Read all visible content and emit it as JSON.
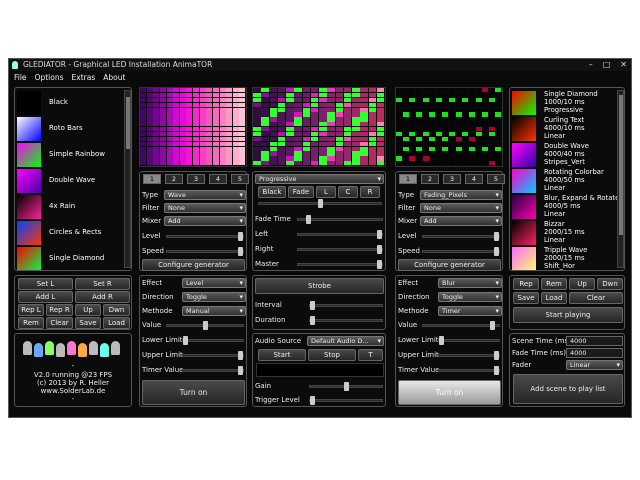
{
  "window": {
    "title": "GLEDIATOR - Graphical LED Installation AnimaTOR",
    "min": "–",
    "max": "□",
    "close": "✕"
  },
  "menu": [
    "File",
    "Options",
    "Extras",
    "About"
  ],
  "generator_list": [
    {
      "label": "Black",
      "colors": [
        "#000000",
        "#000000"
      ]
    },
    {
      "label": "Roto Bars",
      "colors": [
        "#ffffff",
        "#0000ff"
      ]
    },
    {
      "label": "Simple Rainbow",
      "colors": [
        "#ff00ff",
        "#00ff00"
      ]
    },
    {
      "label": "Double Wave",
      "colors": [
        "#ff00ff",
        "#4400aa"
      ]
    },
    {
      "label": "4x Rain",
      "colors": [
        "#000000",
        "#ff2299"
      ]
    },
    {
      "label": "Circles & Rects",
      "colors": [
        "#0044ff",
        "#ff3300"
      ]
    },
    {
      "label": "Single Diamond",
      "colors": [
        "#ff0000",
        "#00ff44"
      ]
    }
  ],
  "tabs": [
    "1",
    "2",
    "3",
    "4",
    "5"
  ],
  "left_panel": {
    "type_label": "Type",
    "type_value": "Wave",
    "filter_label": "Filter",
    "filter_value": "None",
    "mixer_label": "Mixer",
    "mixer_value": "Add",
    "level_label": "Level",
    "speed_label": "Speed",
    "level": 1.0,
    "speed": 1.0,
    "config_btn": "Configure generator"
  },
  "center_panel": {
    "mix_value": "Progressive",
    "buttons": [
      "Black",
      "Fade",
      "L",
      "C",
      "R"
    ],
    "fade_label": "Fade Time",
    "left_label": "Left",
    "right_label": "Right",
    "master_label": "Master",
    "cross": 0.5,
    "fade": 0.1,
    "left": 1.0,
    "right": 1.0,
    "master": 1.0
  },
  "right_panel": {
    "type_label": "Type",
    "type_value": "Fading_Pixels",
    "filter_label": "Filter",
    "filter_value": "None",
    "mixer_label": "Mixer",
    "mixer_value": "Add",
    "level_label": "Level",
    "speed_label": "Speed",
    "level": 1.0,
    "speed": 1.0,
    "config_btn": "Configure generator"
  },
  "playlist": [
    {
      "name": "Single Diamond",
      "time": "1000/10 ms",
      "mode": "Progressive"
    },
    {
      "name": "Curling Text",
      "time": "4000/10 ms",
      "mode": "Linear"
    },
    {
      "name": "Double Wave",
      "time": "4000/40 ms",
      "mode": "Stripes_Vert"
    },
    {
      "name": "Rotating Colorbar",
      "time": "4000/50 ms",
      "mode": "Linear"
    },
    {
      "name": "Blur, Expand & Rotate",
      "time": "4000/5 ms",
      "mode": "Linear"
    },
    {
      "name": "Bizzar",
      "time": "2000/15 ms",
      "mode": "Linear"
    },
    {
      "name": "Tripple Wave",
      "time": "2000/15 ms",
      "mode": "Shift_Hor"
    }
  ],
  "set_buttons": [
    "Set L",
    "Set R",
    "Add L",
    "Add R",
    "Rep L",
    "Rep R",
    "Up",
    "Dwn",
    "Rem",
    "Clear",
    "Save",
    "Load"
  ],
  "info": {
    "version": "V2.0 running @23 FPS",
    "copyright": "(c) 2013 by R. Heller",
    "url": "www.SolderLab.de",
    "dash1": "-",
    "dash2": "-"
  },
  "effect_left": {
    "effect_label": "Effect",
    "effect_value": "Level",
    "direction_label": "Direction",
    "direction_value": "Toggle",
    "methode_label": "Methode",
    "methode_value": "Manual",
    "value_label": "Value",
    "value": 0.5,
    "lower_label": "Lower Limit",
    "lower": 0.0,
    "upper_label": "Upper Limit",
    "upper": 1.0,
    "timer_label": "Timer Value",
    "timer": 1.0,
    "turn_on": "Turn on"
  },
  "strobe": {
    "button": "Strobe",
    "interval_label": "Interval",
    "duration_label": "Duration",
    "interval": 0.0,
    "duration": 0.0
  },
  "audio": {
    "source_label": "Audio Source",
    "source_value": "Default Audio D...",
    "start": "Start",
    "stop": "Stop",
    "t": "T",
    "gain_label": "Gain",
    "trigger_label": "Trigger Level",
    "gain": 0.5,
    "trigger": 0.0
  },
  "effect_right": {
    "effect_label": "Effect",
    "effect_value": "Blur",
    "direction_label": "Direction",
    "direction_value": "Toggle",
    "methode_label": "Methode",
    "methode_value": "Timer",
    "value_label": "Value",
    "value": 0.95,
    "lower_label": "Lower Limit",
    "lower": 0.0,
    "upper_label": "Upper Limit",
    "upper": 1.0,
    "timer_label": "Timer Value",
    "timer": 1.0,
    "turn_on": "Turn on"
  },
  "playlist_buttons": [
    "Rep",
    "Rem",
    "Up",
    "Dwn",
    "Save",
    "Load",
    "Clear"
  ],
  "start_playing": "Start playing",
  "scene": {
    "time_label": "Scene Time (ms)",
    "time_value": "4000",
    "fade_label": "Fade Time (ms)",
    "fade_value": "4000",
    "fader_label": "Fader",
    "fader_value": "Linear",
    "add_btn": "Add scene to play list"
  }
}
